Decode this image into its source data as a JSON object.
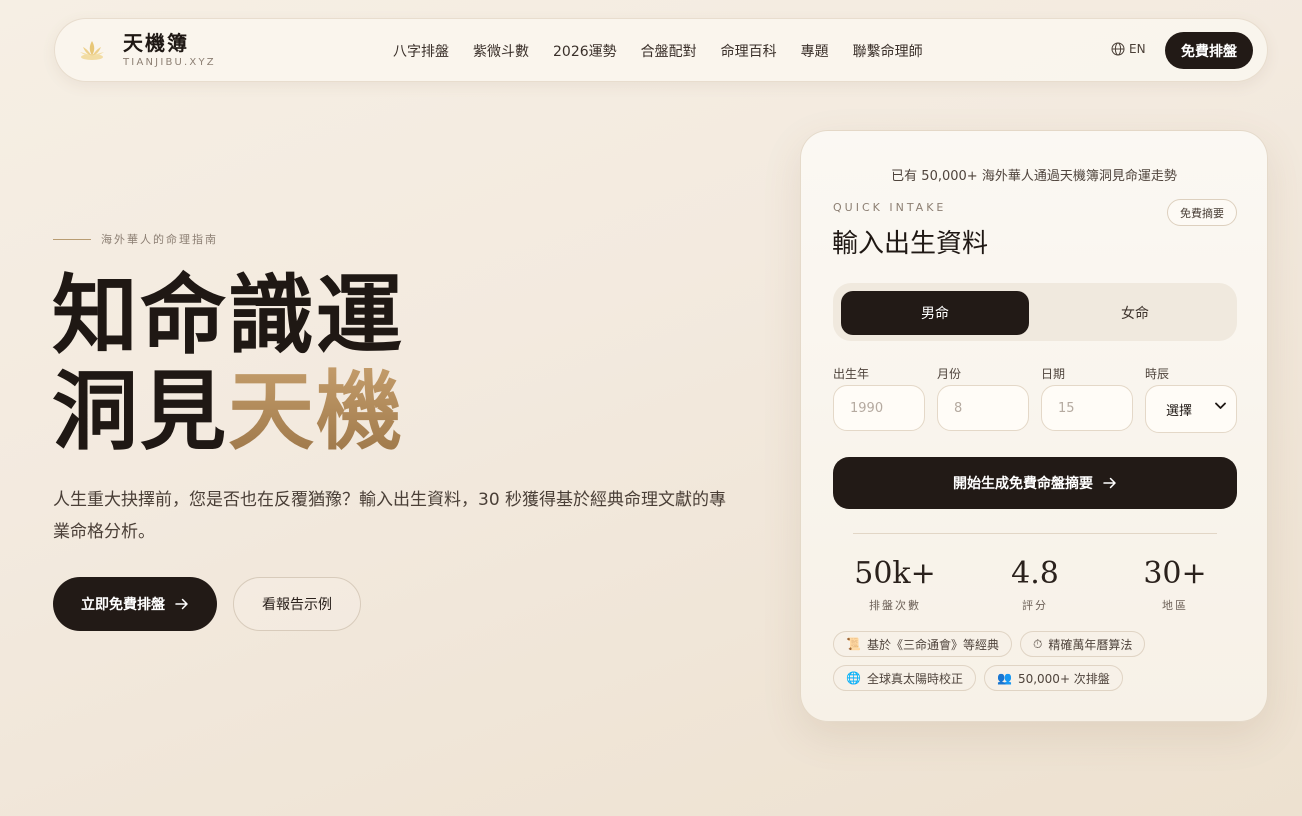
{
  "brand": {
    "name": "天機簿",
    "domain": "TIANJIBU.XYZ"
  },
  "nav": {
    "links": [
      "八字排盤",
      "紫微斗數",
      "2026運勢",
      "合盤配對",
      "命理百科",
      "專題",
      "聯繫命理師"
    ],
    "lang_label": "EN",
    "cta_label": "免費排盤"
  },
  "hero": {
    "eyebrow": "海外華人的命理指南",
    "headline_line1": "知命識運",
    "headline_line2_a": "洞見",
    "headline_line2_b": "天機",
    "subtitle": "人生重大抉擇前，您是否也在反覆猶豫？輸入出生資料，30 秒獲得基於經典命理文獻的專業命格分析。",
    "primary_button": "立即免費排盤",
    "secondary_button": "看報告示例"
  },
  "card": {
    "social_proof": "已有 50,000+ 海外華人通過天機簿洞見命運走勢",
    "eyebrow": "QUICK INTAKE",
    "title": "輸入出生資料",
    "badge": "免費摘要",
    "gender": {
      "male": "男命",
      "female": "女命",
      "selected": "男命"
    },
    "fields": {
      "year_label": "出生年",
      "year_placeholder": "1990",
      "month_label": "月份",
      "month_placeholder": "8",
      "day_label": "日期",
      "day_placeholder": "15",
      "hour_label": "時辰",
      "hour_value": "選擇"
    },
    "submit": "開始生成免費命盤摘要",
    "stats": [
      {
        "value": "50k+",
        "label": "排盤次數"
      },
      {
        "value": "4.8",
        "label": "評分"
      },
      {
        "value": "30+",
        "label": "地區"
      }
    ],
    "chips": [
      {
        "icon": "📜",
        "label": "基於《三命通會》等經典"
      },
      {
        "icon": "⏱",
        "label": "精確萬年曆算法"
      },
      {
        "icon": "🌐",
        "label": "全球真太陽時校正"
      },
      {
        "icon": "👥",
        "label": "50,000+ 次排盤"
      }
    ]
  },
  "colors": {
    "dark": "#221a16",
    "gold": "#b08a5a",
    "background": "#f3eadf"
  }
}
